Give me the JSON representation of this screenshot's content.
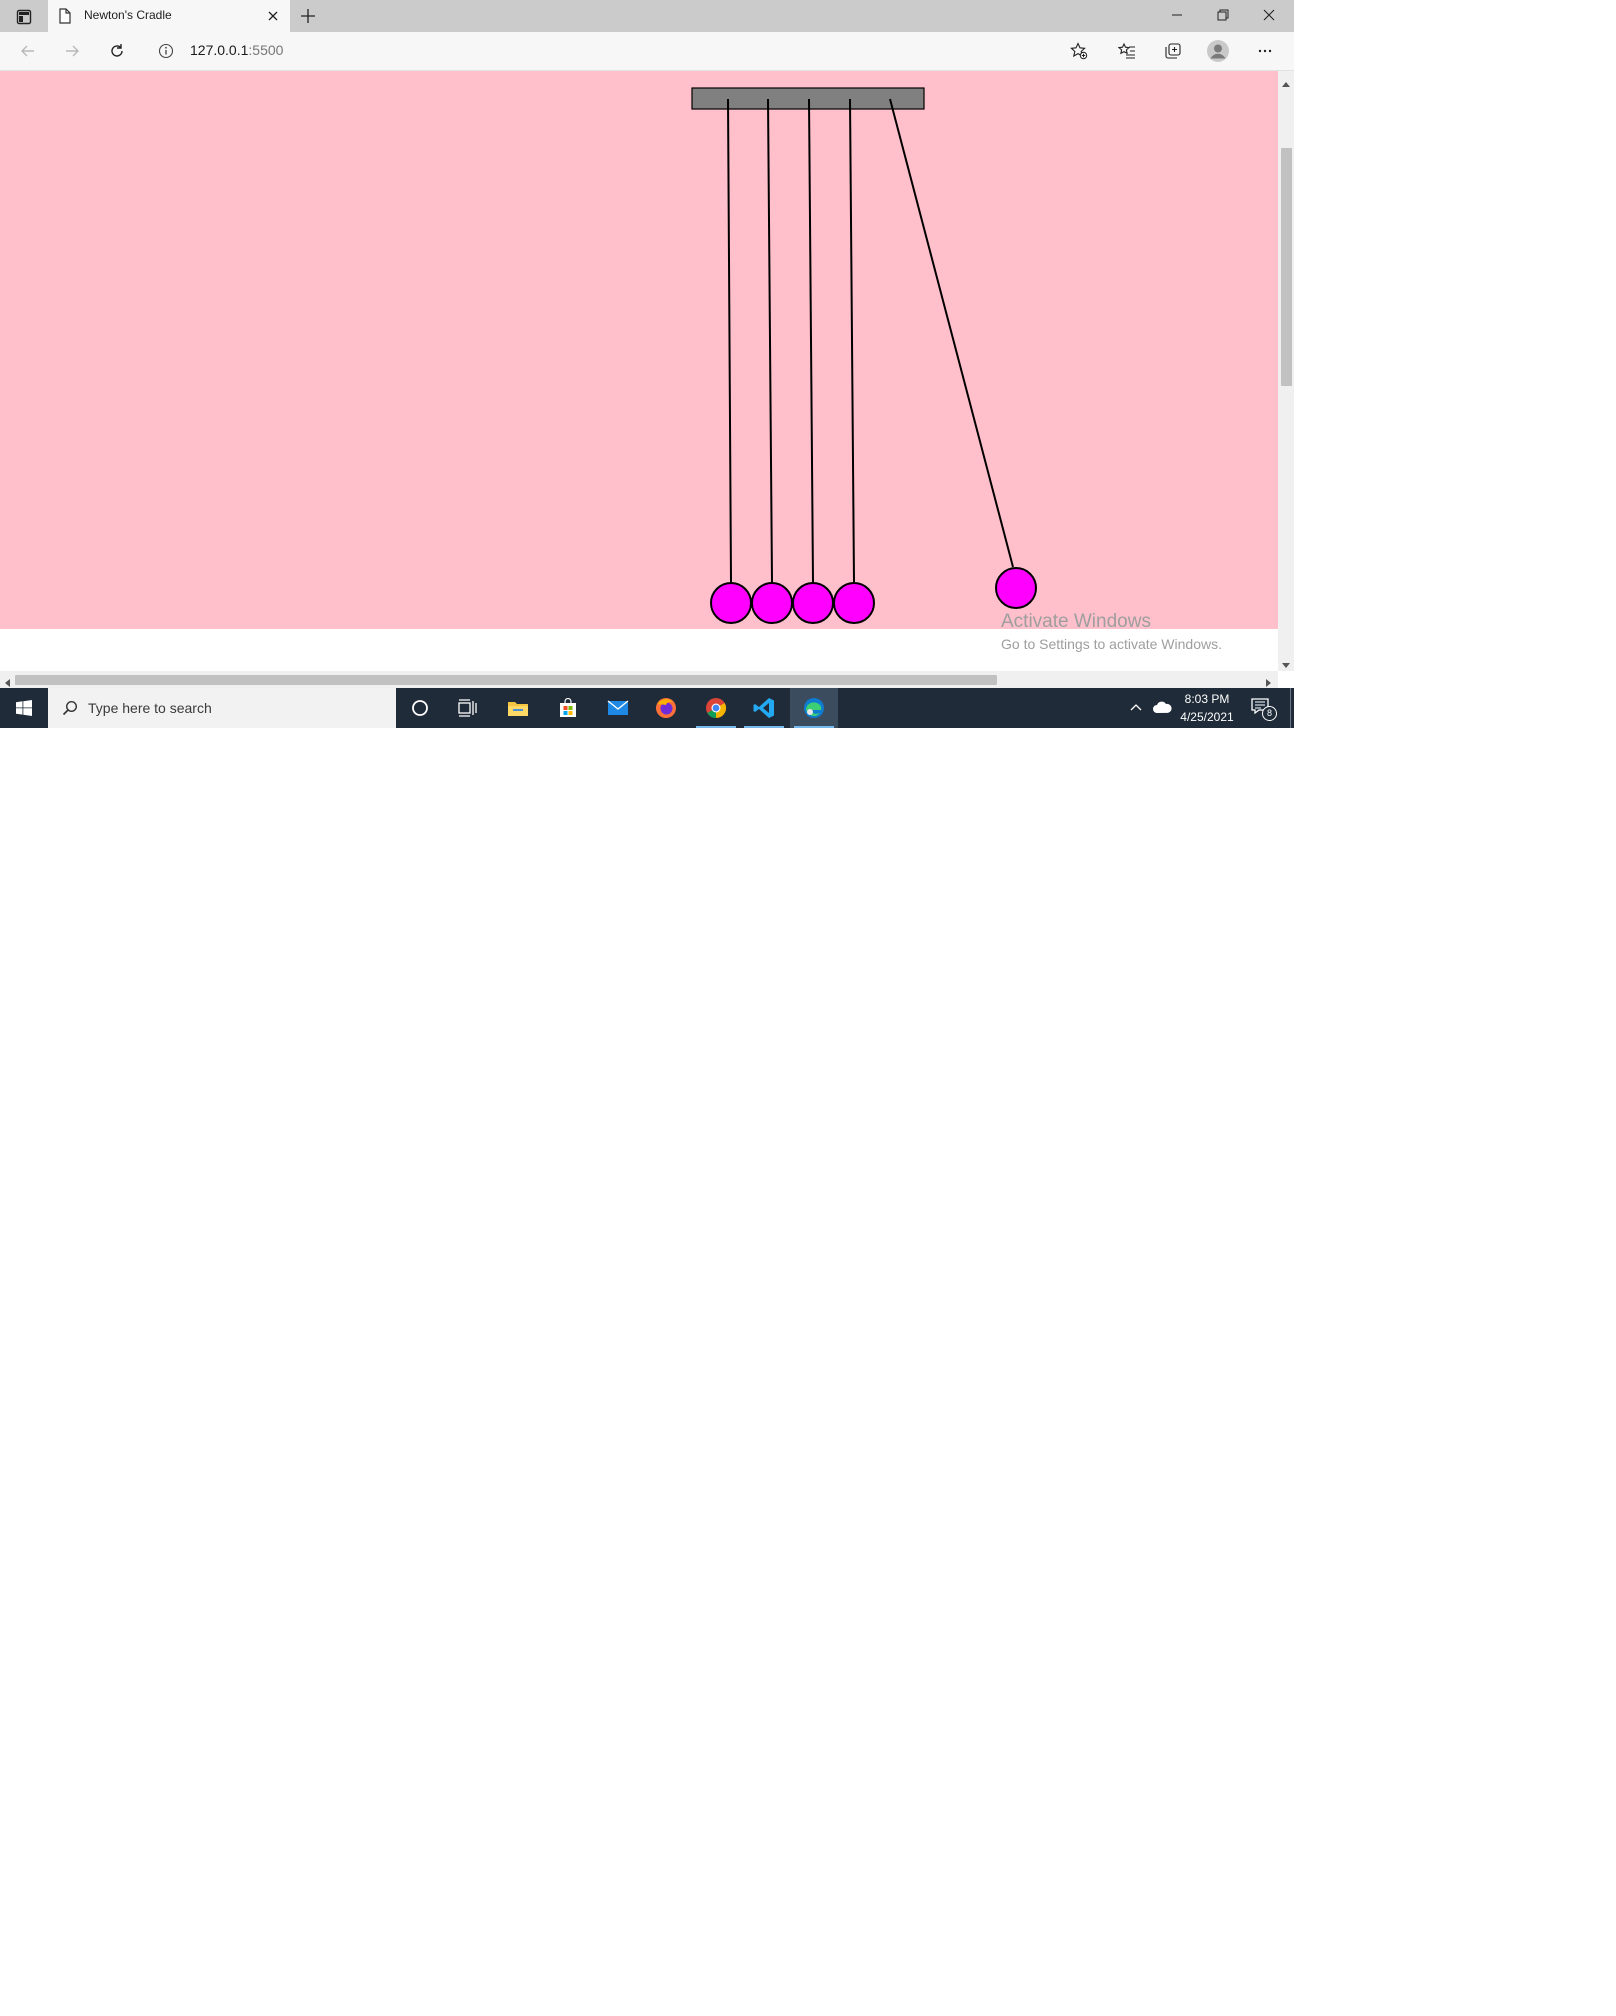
{
  "browser": {
    "tab": {
      "title": "Newton's Cradle",
      "icon": "page-icon",
      "close_icon": "close-icon"
    },
    "new_tab_icon": "plus-icon",
    "window_controls": [
      "minimize-icon",
      "restore-icon",
      "close-icon"
    ],
    "address": {
      "info_icon": "info-icon",
      "host": "127.0.0.1",
      "port": ":5500"
    },
    "toolbar_icons": [
      "back-arrow-icon",
      "forward-arrow-icon",
      "refresh-icon",
      "add-favorite-icon",
      "favorites-icon",
      "collections-icon",
      "profile-icon",
      "more-icon"
    ]
  },
  "page": {
    "background_color": "#ffc0cb",
    "frame_color": "#808080",
    "ball_color": "#ff00ff",
    "string_color": "#000000",
    "balls_at_rest": 4,
    "balls_swung": 1
  },
  "watermark": {
    "title": "Activate Windows",
    "subtitle": "Go to Settings to activate Windows."
  },
  "taskbar": {
    "start_icon": "windows-start-icon",
    "search_placeholder": "Type here to search",
    "apps": [
      "cortana-icon",
      "task-view-icon",
      "file-explorer-icon",
      "store-icon",
      "mail-icon",
      "firefox-icon",
      "chrome-icon",
      "vscode-icon",
      "edge-icon"
    ],
    "time": "8:03 PM",
    "date": "4/25/2021",
    "notification_count": "8"
  }
}
